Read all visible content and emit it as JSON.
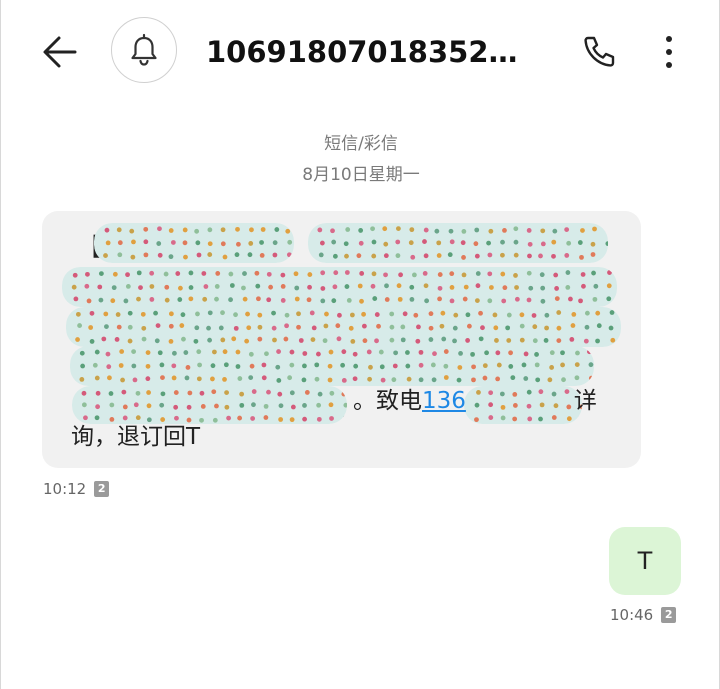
{
  "header": {
    "title": "106918070183524…",
    "back_icon": "arrow-left-icon",
    "avatar_icon": "bell-icon",
    "call_icon": "phone-icon",
    "more_icon": "more-vertical-icon"
  },
  "conversation": {
    "type_label": "短信/彩信",
    "date_label": "8月10日星期一"
  },
  "incoming": {
    "visible_open_bracket": "【",
    "line5_prefix": "。致电",
    "phone_visible": "136",
    "line5_suffix": "详",
    "line6": "询，退订回T",
    "time": "10:12",
    "sim": "2",
    "redacted": true
  },
  "outgoing": {
    "text": "T",
    "time": "10:46",
    "sim": "2"
  },
  "colors": {
    "incoming_bubble": "#f1f1f1",
    "outgoing_bubble": "#dcf5d6",
    "link": "#1e88e5"
  }
}
